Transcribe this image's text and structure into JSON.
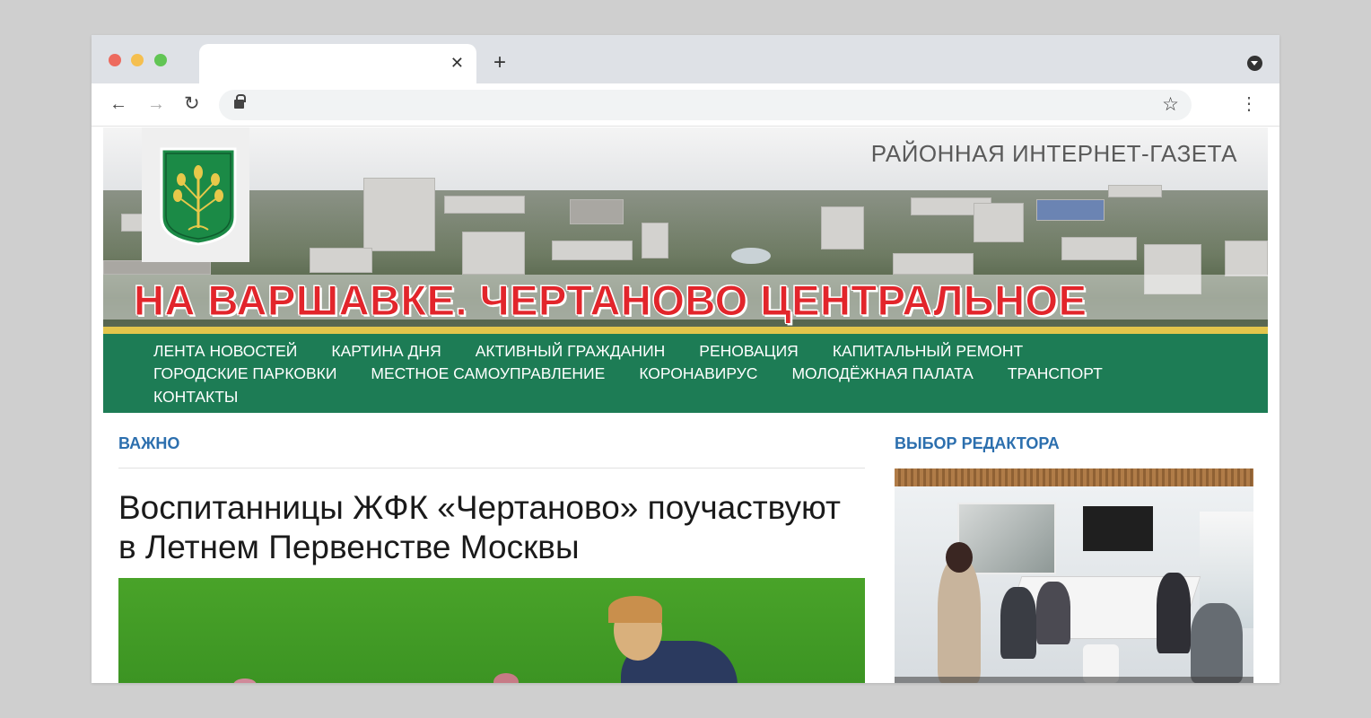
{
  "browser": {
    "tab_close_icon": "close-icon",
    "new_tab_glyph": "+",
    "back_glyph": "←",
    "forward_glyph": "→",
    "reload_glyph": "↻",
    "star_glyph": "☆",
    "menu_glyph": "⋮"
  },
  "site": {
    "subtitle": "РАЙОННАЯ ИНТЕРНЕТ-ГАЗЕТА",
    "title": "НА ВАРШАВКЕ. ЧЕРТАНОВО ЦЕНТРАЛЬНОЕ",
    "brand_colors": {
      "green": "#1d7c55",
      "red": "#e2252b",
      "gold": "#e3c54b",
      "link_blue": "#2c6fae"
    }
  },
  "nav": {
    "row1": [
      "ЛЕНТА НОВОСТЕЙ",
      "КАРТИНА ДНЯ",
      "АКТИВНЫЙ ГРАЖДАНИН",
      "РЕНОВАЦИЯ",
      "КАПИТАЛЬНЫЙ РЕМОНТ"
    ],
    "row2": [
      "ГОРОДСКИЕ ПАРКОВКИ",
      "МЕСТНОЕ САМОУПРАВЛЕНИЕ",
      "КОРОНАВИРУС",
      "МОЛОДЁЖНАЯ ПАЛАТА",
      "ТРАНСПОРТ"
    ],
    "row3": [
      "КОНТАКТЫ"
    ]
  },
  "main": {
    "section_label": "ВАЖНО",
    "headline": "Воспитанницы ЖФК «Чертаново» поучаствуют в Летнем Первенстве Москвы"
  },
  "sidebar": {
    "section_label": "ВЫБОР РЕДАКТОРА"
  }
}
